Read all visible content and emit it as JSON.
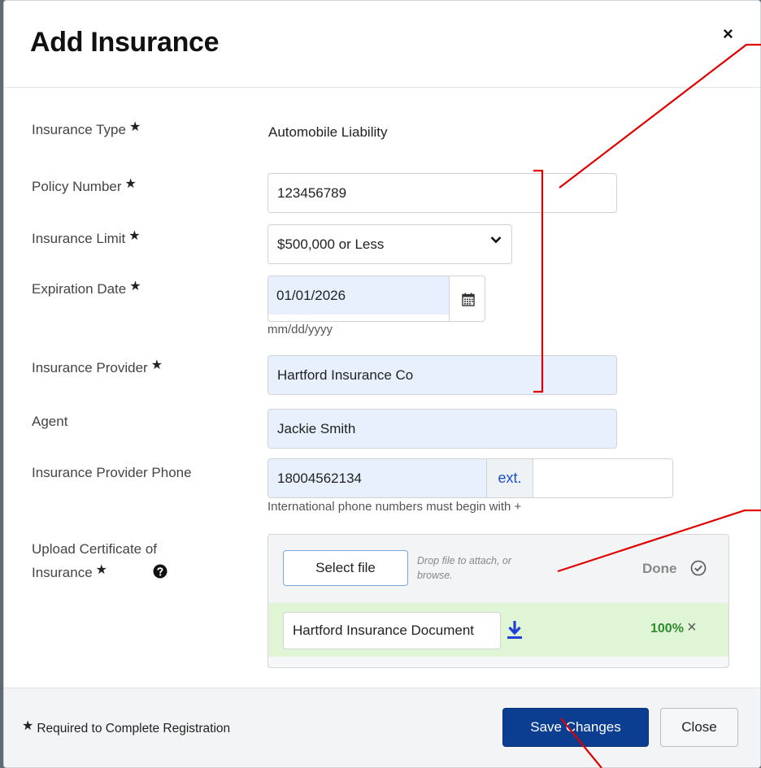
{
  "modal": {
    "title": "Add Insurance",
    "close_glyph": "×"
  },
  "form": {
    "insurance_type": {
      "label": "Insurance Type",
      "value": "Automobile Liability"
    },
    "policy_number": {
      "label": "Policy Number",
      "value": "123456789"
    },
    "insurance_limit": {
      "label": "Insurance Limit",
      "value": "$500,000 or Less"
    },
    "expiration_date": {
      "label": "Expiration Date",
      "value": "01/01/2026",
      "hint": "mm/dd/yyyy"
    },
    "insurance_provider": {
      "label": "Insurance Provider",
      "value": "Hartford Insurance Co"
    },
    "agent": {
      "label": "Agent",
      "value": "Jackie Smith"
    },
    "provider_phone": {
      "label": "Insurance Provider Phone",
      "value": "18004562134",
      "ext_label": "ext.",
      "ext_value": "",
      "hint": "International phone numbers must begin with +"
    },
    "upload": {
      "label_line1": "Upload Certificate of",
      "label_line2": "Insurance",
      "select_button": "Select file",
      "drop_text_line1": "Drop file to attach, or",
      "drop_text_line2": "browse.",
      "status": "Done",
      "file_name": "Hartford Insurance Document",
      "progress_label": "100%",
      "progress": 1.0
    },
    "required_star": "★"
  },
  "footer": {
    "required_note": "Required to Complete Registration",
    "save_label": "Save Changes",
    "close_label": "Close"
  },
  "icons": {
    "calendar": "calendar-icon",
    "chevron": "chevron-down-icon",
    "help": "question-circle-icon",
    "done": "check-circle-icon",
    "download": "download-icon",
    "remove": "close-icon"
  },
  "colors": {
    "primary": "#0b3d91",
    "autofill": "#e8f0fe",
    "success_row": "#dff5d6",
    "success_text": "#2e8b2e",
    "annotation": "#e00000",
    "link": "#1a4fd0"
  }
}
